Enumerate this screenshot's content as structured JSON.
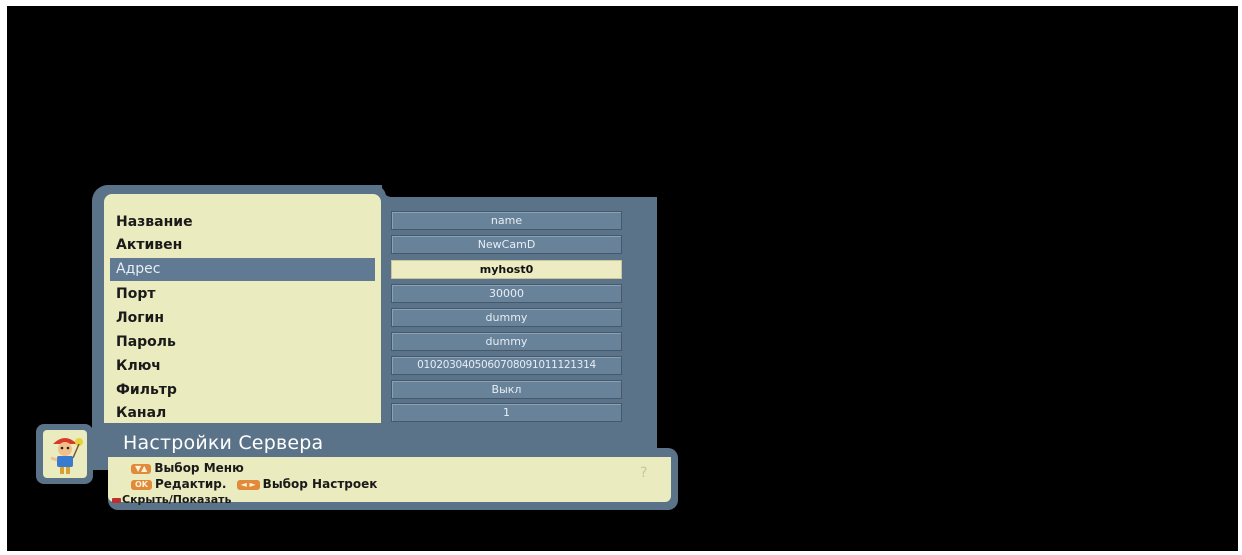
{
  "menu": {
    "title": "Настройки Сервера",
    "selected_index": 2,
    "items": [
      {
        "label": "Название",
        "value": "name"
      },
      {
        "label": "Активен",
        "value": "NewCamD"
      },
      {
        "label": "Адрес",
        "value": "myhost0"
      },
      {
        "label": "Порт",
        "value": "30000"
      },
      {
        "label": "Логин",
        "value": "dummy"
      },
      {
        "label": "Пароль",
        "value": "dummy"
      },
      {
        "label": "Ключ",
        "value": "0102030405060708091011121314"
      },
      {
        "label": "Фильтр",
        "value": "Выкл"
      },
      {
        "label": "Канал",
        "value": "1"
      }
    ]
  },
  "help": {
    "line1": "Выбор Меню",
    "line2_a": "Редактир.",
    "line2_b": "Выбор Настроек",
    "line3": "Скрыть/Показать",
    "ok_key": "OK",
    "up_down_key": "▼▲",
    "left_right_key": "◄ ►",
    "help_icon": "?"
  },
  "colors": {
    "panel": "#ebebc0",
    "frame": "#5b7389",
    "selection": "#5f7a92",
    "key_orange": "#e08a3a",
    "red_key": "#c0302a"
  },
  "icons": [
    "mascot-icon",
    "help-question-icon",
    "up-down-arrows-icon",
    "left-right-arrows-icon",
    "red-key-icon"
  ]
}
